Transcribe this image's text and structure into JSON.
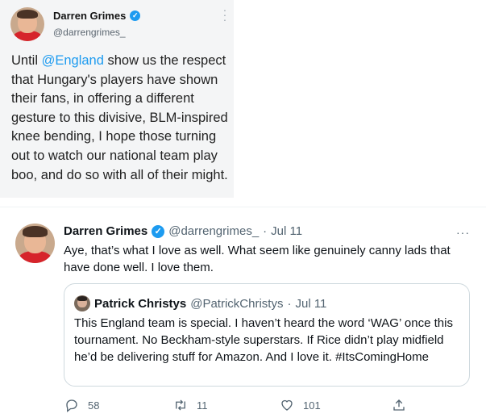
{
  "embedded_tweet": {
    "name": "Darren Grimes",
    "handle": "@darrengrimes_",
    "text_mention": "@England",
    "text_before": "Until ",
    "text_after": " show us the respect that Hungary's players have shown their fans, in offering a different gesture to this divisive, BLM-inspired knee bending, I hope those turning out to watch our national team play boo, and do so with all of their might."
  },
  "tweet": {
    "name": "Darren Grimes",
    "handle": "@darrengrimes_",
    "sep": "·",
    "date": "Jul 11",
    "more": "···",
    "text": "Aye, that’s what I love as well. What seem like genuinely canny lads that have done well. I love them."
  },
  "quote": {
    "name": "Patrick Christys",
    "handle": "@PatrickChristys",
    "sep": "·",
    "date": "Jul 11",
    "text": "This England team is special. I haven’t heard the word ‘WAG’ once this tournament. No Beckham-style superstars. If Rice didn’t play midfield he’d be delivering stuff for Amazon. And I love it. #ItsComingHome"
  },
  "actions": {
    "replies": "58",
    "retweets": "11",
    "likes": "101"
  },
  "colors": {
    "accent": "#1d9bf0",
    "secondary_text": "#536471",
    "border": "#cfd9de"
  },
  "icons": [
    "verified-badge-icon",
    "more-options-icon",
    "reply-icon",
    "retweet-icon",
    "like-icon",
    "share-icon"
  ]
}
